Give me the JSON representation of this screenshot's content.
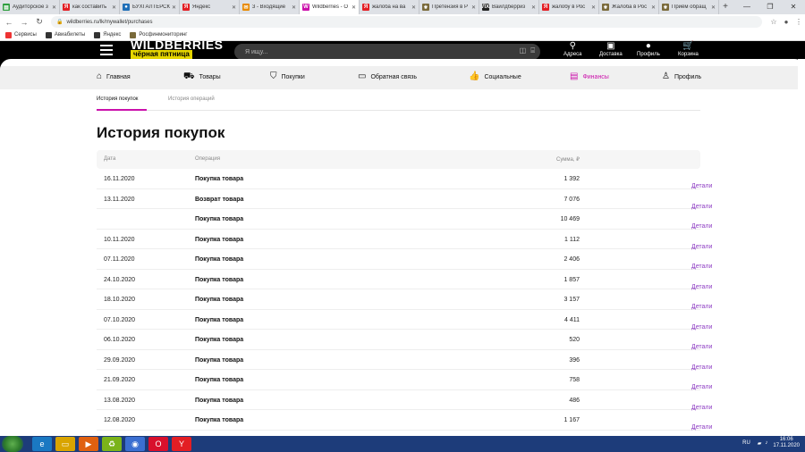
{
  "browser": {
    "tabs": [
      {
        "label": "Аудиторское з",
        "color": "#2e9e3e",
        "glyph": "▤"
      },
      {
        "label": "как составить",
        "color": "#e31e24",
        "glyph": "Я"
      },
      {
        "label": "БУХГАЛТЕРСК",
        "color": "#1f6fb8",
        "glyph": "●"
      },
      {
        "label": "Яндекс",
        "color": "#e31e24",
        "glyph": "Я"
      },
      {
        "label": "3 - Входящие",
        "color": "#e88a00",
        "glyph": "✉"
      },
      {
        "label": "Wildberries - О",
        "color": "#cb11ab",
        "glyph": "W",
        "active": true
      },
      {
        "label": "жалоба на ва",
        "color": "#e31e24",
        "glyph": "Я"
      },
      {
        "label": "Претензия в Р",
        "color": "#7a6a3a",
        "glyph": "⚜"
      },
      {
        "label": "Вайлдберриз",
        "color": "#222222",
        "glyph": "ЛХ"
      },
      {
        "label": "жалобу в Рос",
        "color": "#e31e24",
        "glyph": "Я"
      },
      {
        "label": "Жалоба в Рос",
        "color": "#7a6a3a",
        "glyph": "⚜"
      },
      {
        "label": "Приём обращ",
        "color": "#7a6a3a",
        "glyph": "⚜"
      }
    ],
    "url": "wildberries.ru/lk/mywallet/purchases",
    "bookmarks": [
      {
        "label": "Сервисы",
        "color": "#e33"
      },
      {
        "label": "Авиабилеты",
        "color": "#333"
      },
      {
        "label": "Яндекс",
        "color": "#333"
      },
      {
        "label": "Росфинмониторинг",
        "color": "#7a6a3a"
      }
    ]
  },
  "header": {
    "logo": "WILDBERRIES",
    "logo_sub": "чёрная пятница",
    "search_placeholder": "Я ищу...",
    "icons": [
      {
        "label": "Адреса",
        "icon": "map-pin-icon",
        "glyph": "⚲"
      },
      {
        "label": "Доставка",
        "icon": "box-icon",
        "glyph": "▣"
      },
      {
        "label": "Профиль",
        "icon": "user-icon",
        "glyph": "●"
      },
      {
        "label": "Корзина",
        "icon": "cart-icon",
        "glyph": "🛒"
      }
    ]
  },
  "nav": [
    {
      "label": "Главная",
      "icon": "home-icon",
      "glyph": "⌂"
    },
    {
      "label": "Товары",
      "icon": "products-icon",
      "glyph": "⛟"
    },
    {
      "label": "Покупки",
      "icon": "bag-icon",
      "glyph": "⛉"
    },
    {
      "label": "Обратная связь",
      "icon": "feedback-icon",
      "glyph": "▭"
    },
    {
      "label": "Социальные",
      "icon": "like-icon",
      "glyph": "👍"
    },
    {
      "label": "Финансы",
      "icon": "wallet-icon",
      "glyph": "▤",
      "active": true
    },
    {
      "label": "Профиль",
      "icon": "user-icon",
      "glyph": "♙"
    }
  ],
  "subtabs": [
    "История покупок",
    "История операций"
  ],
  "page_title": "История покупок",
  "table": {
    "headers": {
      "date": "Дата",
      "operation": "Операция",
      "sum": "Сумма, ₽"
    },
    "details_label": "Детали",
    "rows": [
      {
        "date": "16.11.2020",
        "op": "Покупка товара",
        "sum": "1 392"
      },
      {
        "date": "13.11.2020",
        "op": "Возврат товара",
        "sum": "7 076"
      },
      {
        "date": "",
        "op": "Покупка товара",
        "sum": "10 469"
      },
      {
        "date": "10.11.2020",
        "op": "Покупка товара",
        "sum": "1 112"
      },
      {
        "date": "07.11.2020",
        "op": "Покупка товара",
        "sum": "2 406"
      },
      {
        "date": "24.10.2020",
        "op": "Покупка товара",
        "sum": "1 857"
      },
      {
        "date": "18.10.2020",
        "op": "Покупка товара",
        "sum": "3 157"
      },
      {
        "date": "07.10.2020",
        "op": "Покупка товара",
        "sum": "4 411"
      },
      {
        "date": "06.10.2020",
        "op": "Покупка товара",
        "sum": "520"
      },
      {
        "date": "29.09.2020",
        "op": "Покупка товара",
        "sum": "396"
      },
      {
        "date": "21.09.2020",
        "op": "Покупка товара",
        "sum": "758"
      },
      {
        "date": "13.08.2020",
        "op": "Покупка товара",
        "sum": "486"
      },
      {
        "date": "12.08.2020",
        "op": "Покупка товара",
        "sum": "1 167"
      }
    ]
  },
  "taskbar": {
    "lang": "RU",
    "time": "16:06",
    "date": "17.11.2020",
    "apps": [
      {
        "name": "ie-icon",
        "color": "#1a78c2",
        "glyph": "e"
      },
      {
        "name": "explorer-icon",
        "color": "#d9a400",
        "glyph": "▭"
      },
      {
        "name": "media-player-icon",
        "color": "#e06010",
        "glyph": "▶"
      },
      {
        "name": "recycle-icon",
        "color": "#7bb31a",
        "glyph": "♻"
      },
      {
        "name": "chrome-icon",
        "color": "#3b6fd1",
        "glyph": "◉"
      },
      {
        "name": "opera-icon",
        "color": "#d8102c",
        "glyph": "O"
      },
      {
        "name": "yandex-browser-icon",
        "color": "#e31e24",
        "glyph": "Y"
      }
    ]
  }
}
